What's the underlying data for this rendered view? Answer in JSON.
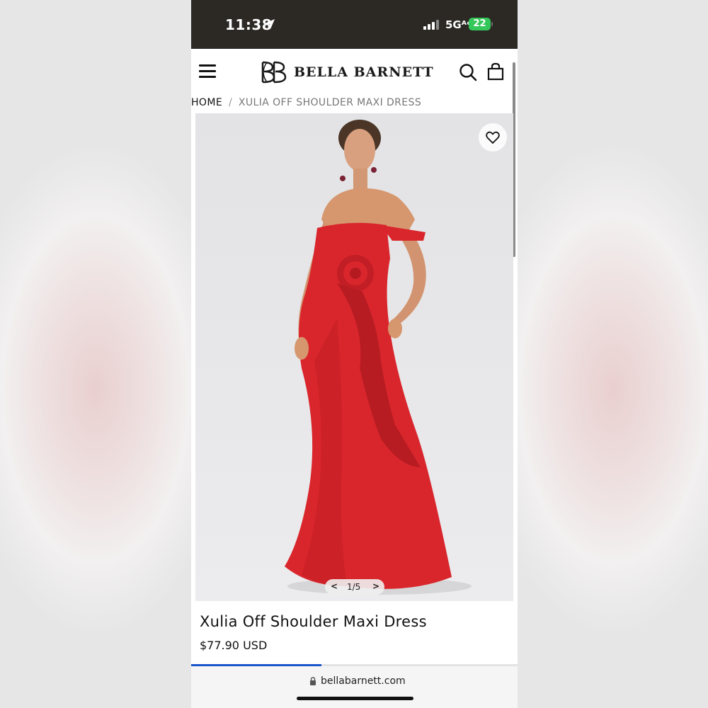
{
  "status_bar": {
    "time": "11:38",
    "network": "5Gᴬᶜ",
    "battery": "22"
  },
  "header": {
    "brand": "BELLA BARNETT"
  },
  "breadcrumb": {
    "home": "HOME",
    "separator": "/",
    "current": "XULIA OFF SHOULDER MAXI DRESS"
  },
  "gallery": {
    "counter": "1/5",
    "prev": "<",
    "next": ">"
  },
  "product": {
    "title": "Xulia Off Shoulder Maxi Dress",
    "price": "$77.90 USD"
  },
  "browser": {
    "url": "bellabarnett.com",
    "load_progress": 0.4
  },
  "colors": {
    "status_bar": "#2c2925",
    "dress": "#d9262c",
    "accent": "#1a56c9",
    "battery": "#34c759"
  },
  "icons": [
    "location-arrow-icon",
    "signal-icon",
    "battery-icon",
    "menu-icon",
    "brand-logo-icon",
    "search-icon",
    "bag-icon",
    "heart-icon",
    "lock-icon"
  ]
}
